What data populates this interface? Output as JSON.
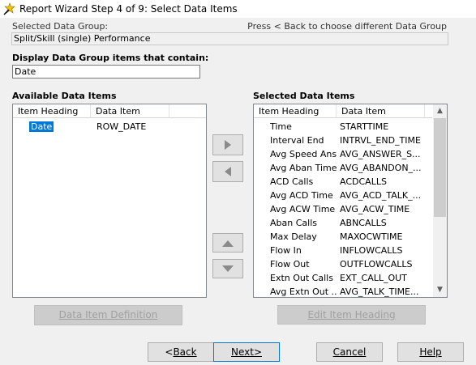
{
  "window": {
    "title": "Report Wizard Step 4 of 9: Select Data Items"
  },
  "header": {
    "selected_group_label": "Selected Data Group:",
    "back_hint": "Press < Back to choose different Data Group",
    "selected_group_value": "Split/Skill (single) Performance"
  },
  "filter": {
    "label": "Display Data Group items that contain:",
    "value": "Date"
  },
  "available": {
    "title": "Available Data Items",
    "columns": [
      "Item Heading",
      "Data Item"
    ],
    "rows": [
      {
        "heading": "Date",
        "item": "ROW_DATE"
      }
    ]
  },
  "selected": {
    "title": "Selected Data Items",
    "columns": [
      "Item Heading",
      "Data Item"
    ],
    "rows": [
      {
        "heading": "Time",
        "item": "STARTTIME"
      },
      {
        "heading": "Interval End",
        "item": "INTRVL_END_TIME"
      },
      {
        "heading": "Avg Speed Ans",
        "item": "AVG_ANSWER_S..."
      },
      {
        "heading": "Avg Aban Time",
        "item": "AVG_ABANDON_..."
      },
      {
        "heading": "ACD Calls",
        "item": "ACDCALLS"
      },
      {
        "heading": "Avg ACD Time",
        "item": "AVG_ACD_TALK_..."
      },
      {
        "heading": "Avg ACW Time",
        "item": "AVG_ACW_TIME"
      },
      {
        "heading": "Aban Calls",
        "item": "ABNCALLS"
      },
      {
        "heading": "Max Delay",
        "item": "MAXOCWTIME"
      },
      {
        "heading": "Flow In",
        "item": "INFLOWCALLS"
      },
      {
        "heading": "Flow Out",
        "item": "OUTFLOWCALLS"
      },
      {
        "heading": "Extn Out Calls",
        "item": "EXT_CALL_OUT"
      },
      {
        "heading": "Avg Extn Out ...",
        "item": "AVG_TALK_TIME..."
      }
    ]
  },
  "buttons": {
    "data_item_definition": "Data Item Definition",
    "edit_item_heading": "Edit Item Heading",
    "back": "Back",
    "back_prefix": "<",
    "next": "Next>",
    "cancel": "Cancel",
    "help": "Help"
  },
  "colors": {
    "selection": "#0078d7",
    "disabled_text": "#a0a0a0"
  },
  "icons": {
    "add": "triangle-right-icon",
    "remove": "triangle-left-icon",
    "move_up": "triangle-up-icon",
    "move_down": "triangle-down-icon",
    "app": "wizard-wand-icon"
  }
}
